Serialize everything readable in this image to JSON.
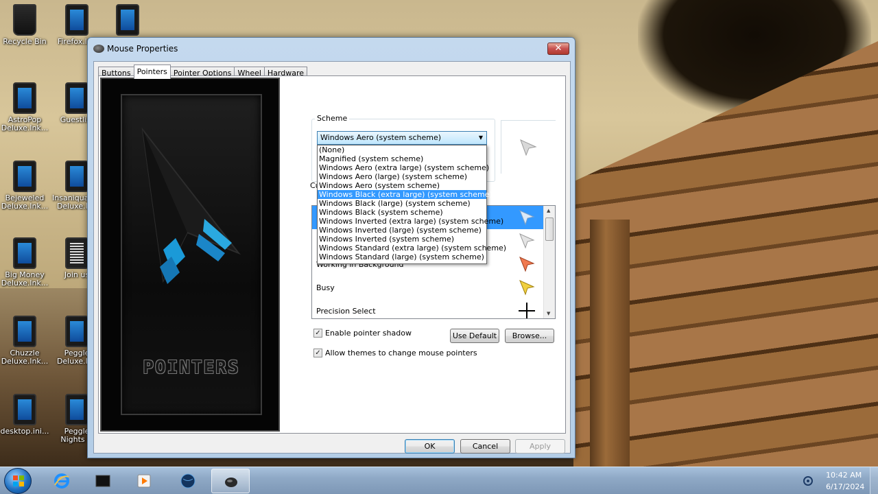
{
  "desktop": {
    "icons": [
      {
        "label": "Recycle Bin"
      },
      {
        "label": "Firefox.lnk"
      },
      {
        "label": ""
      },
      {
        "label": "AstroPop Deluxe.lnk..."
      },
      {
        "label": "Guestlist"
      },
      {
        "label": "Bejeweled Deluxe.lnk..."
      },
      {
        "label": "Insaniquarium Deluxe.lnk"
      },
      {
        "label": "Big Money Deluxe.lnk..."
      },
      {
        "label": "Join us"
      },
      {
        "label": "Chuzzle Deluxe.lnk..."
      },
      {
        "label": "Peggle Deluxe.lnk"
      },
      {
        "label": "desktop.ini..."
      },
      {
        "label": "Peggle Nights D"
      }
    ]
  },
  "window": {
    "title": "Mouse Properties",
    "close_label": "✕",
    "tabs": [
      {
        "label": "Buttons"
      },
      {
        "label": "Pointers"
      },
      {
        "label": "Pointer Options"
      },
      {
        "label": "Wheel"
      },
      {
        "label": "Hardware"
      }
    ],
    "active_tab": "Pointers",
    "art_text": "POINTERS",
    "scheme": {
      "legend": "Scheme",
      "selected": "Windows Aero (system scheme)",
      "options": [
        "(None)",
        "Magnified (system scheme)",
        "Windows Aero (extra large) (system scheme)",
        "Windows Aero (large) (system scheme)",
        "Windows Aero (system scheme)",
        "Windows Black (extra large) (system scheme)",
        "Windows Black (large) (system scheme)",
        "Windows Black (system scheme)",
        "Windows Inverted (extra large) (system scheme)",
        "Windows Inverted (large) (system scheme)",
        "Windows Inverted (system scheme)",
        "Windows Standard (extra large) (system scheme)",
        "Windows Standard (large) (system scheme)"
      ],
      "highlighted": "Windows Black (extra large) (system scheme)"
    },
    "customize_label": "Cu",
    "cursors": [
      {
        "name": "",
        "icon": "arrow-blue-icon"
      },
      {
        "name": "",
        "icon": "help-select-icon"
      },
      {
        "name": "Working in Background",
        "icon": "working-icon"
      },
      {
        "name": "Busy",
        "icon": "busy-icon"
      },
      {
        "name": "Precision Select",
        "icon": "crosshair-icon"
      }
    ],
    "enable_shadow_label": "Enable pointer shadow",
    "enable_shadow_checked": true,
    "allow_themes_label": "Allow themes to change mouse pointers",
    "allow_themes_checked": true,
    "use_default_label": "Use Default",
    "browse_label": "Browse...",
    "ok_label": "OK",
    "cancel_label": "Cancel",
    "apply_label": "Apply"
  },
  "taskbar": {
    "items": [
      {
        "icon": "internet-explorer-icon"
      },
      {
        "icon": "terminal-icon"
      },
      {
        "icon": "media-player-icon"
      },
      {
        "icon": "globe-icon"
      },
      {
        "icon": "mouse-icon",
        "active": true
      }
    ],
    "time": "10:42 AM",
    "date": "6/17/2024"
  }
}
